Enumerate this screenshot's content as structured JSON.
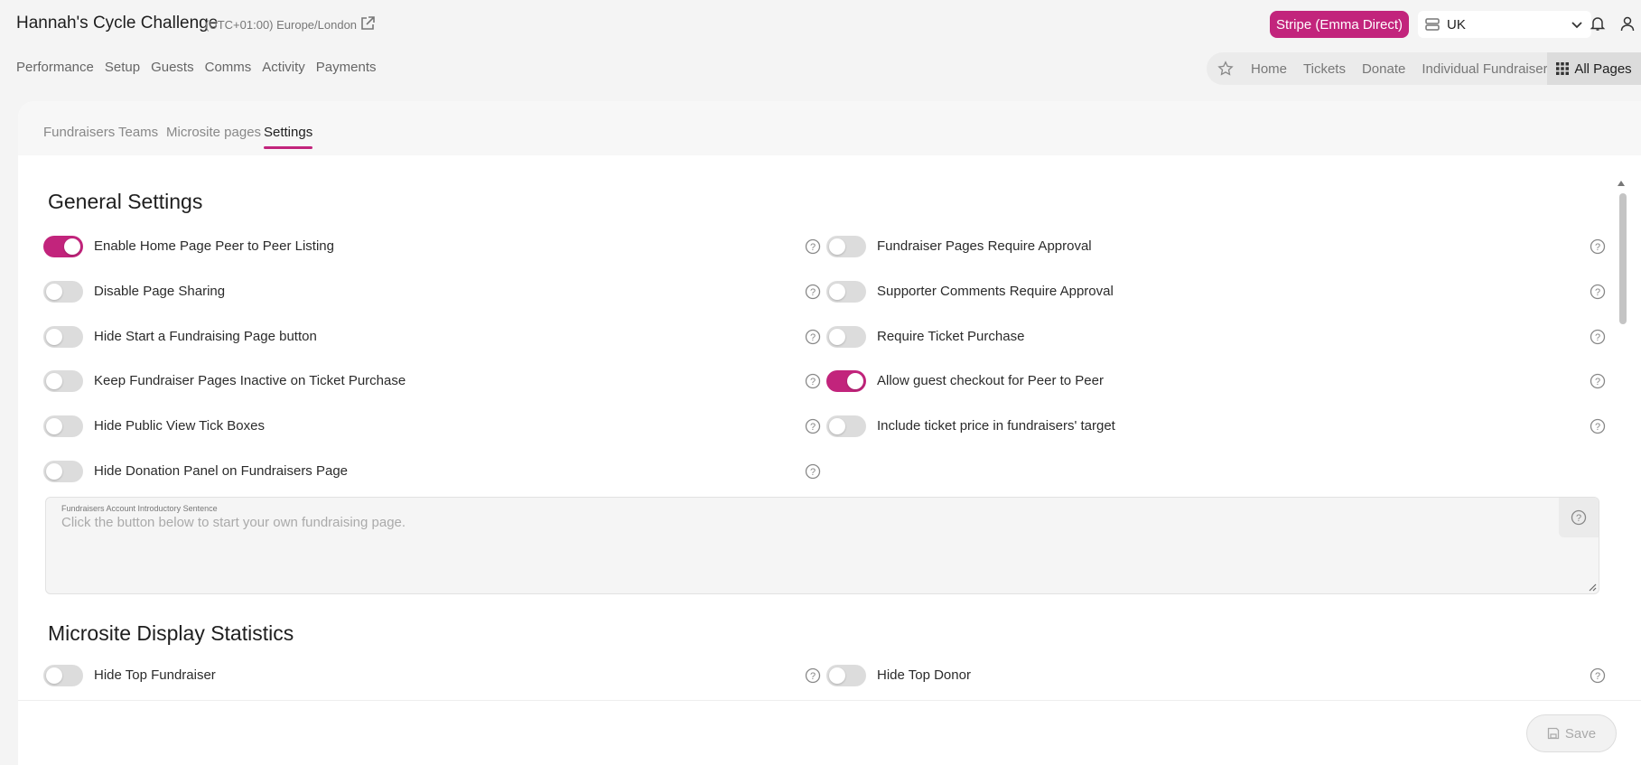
{
  "header": {
    "event_title": "Hannah's Cycle Challenge",
    "timezone": "(UTC+01:00) Europe/London",
    "stripe_button": "Stripe (Emma Direct)",
    "region": "UK"
  },
  "main_nav": [
    "Performance",
    "Setup",
    "Guests",
    "Comms",
    "Activity",
    "Payments"
  ],
  "quick_nav": {
    "items": [
      "Home",
      "Tickets",
      "Donate",
      "Individual Fundraisers"
    ],
    "all_pages": "All Pages"
  },
  "sub_tabs": {
    "items": [
      "Fundraisers",
      "Teams",
      "Microsite pages",
      "Settings"
    ],
    "active": "Settings"
  },
  "general_settings": {
    "title": "General Settings",
    "left": [
      {
        "label": "Enable Home Page Peer to Peer Listing",
        "on": true
      },
      {
        "label": "Disable Page Sharing",
        "on": false
      },
      {
        "label": "Hide Start a Fundraising Page button",
        "on": false
      },
      {
        "label": "Keep Fundraiser Pages Inactive on Ticket Purchase",
        "on": false
      },
      {
        "label": "Hide Public View Tick Boxes",
        "on": false
      },
      {
        "label": "Hide Donation Panel on Fundraisers Page",
        "on": false
      }
    ],
    "right": [
      {
        "label": "Fundraiser Pages Require Approval",
        "on": false
      },
      {
        "label": "Supporter Comments Require Approval",
        "on": false
      },
      {
        "label": "Require Ticket Purchase",
        "on": false
      },
      {
        "label": "Allow guest checkout for Peer to Peer",
        "on": true
      },
      {
        "label": "Include ticket price in fundraisers' target",
        "on": false
      }
    ],
    "intro_field": {
      "label": "Fundraisers Account Introductory Sentence",
      "placeholder": "Click the button below to start your own fundraising page."
    }
  },
  "microsite_stats": {
    "title": "Microsite Display Statistics",
    "left": [
      {
        "label": "Hide Top Fundraiser",
        "on": false
      }
    ],
    "right": [
      {
        "label": "Hide Top Donor",
        "on": false
      }
    ]
  },
  "footer": {
    "save_label": "Save"
  },
  "colors": {
    "accent": "#c2247c",
    "toggle_off": "#dcdcdc"
  }
}
